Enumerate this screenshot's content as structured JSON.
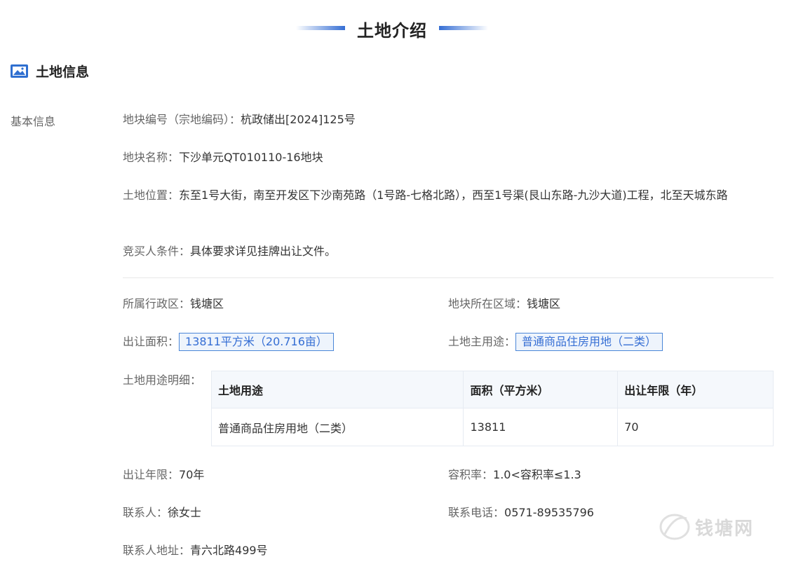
{
  "header": {
    "title": "土地介绍"
  },
  "section": {
    "title": "土地信息"
  },
  "side_label": "基本信息",
  "basic": {
    "parcel_no": {
      "label": "地块编号（宗地编码）：",
      "value": "杭政储出[2024]125号"
    },
    "parcel_name": {
      "label": "地块名称：",
      "value": "下沙单元QT010110-16地块"
    },
    "location": {
      "label": "土地位置：",
      "value": "东至1号大街，南至开发区下沙南苑路（1号路-七格北路），西至1号渠(艮山东路-九沙大道)工程，北至天城东路"
    },
    "bidder": {
      "label": "竞买人条件：",
      "value": "具体要求详见挂牌出让文件。"
    }
  },
  "details": {
    "district": {
      "label": "所属行政区：",
      "value": "钱塘区"
    },
    "area_region": {
      "label": "地块所在区域：",
      "value": "钱塘区"
    },
    "land_area": {
      "label": "出让面积：",
      "value": "13811平方米（20.716亩）"
    },
    "main_use": {
      "label": "土地主用途：",
      "value": "普通商品住房用地（二类）"
    },
    "use_detail_label": "土地用途明细：",
    "term": {
      "label": "出让年限：",
      "value": "70年"
    },
    "far": {
      "label": "容积率：",
      "value": "1.0<容积率≤1.3"
    },
    "contact": {
      "label": "联系人：",
      "value": "徐女士"
    },
    "phone": {
      "label": "联系电话：",
      "value": "0571-89535796"
    },
    "address": {
      "label": "联系人地址：",
      "value": "青六北路499号"
    }
  },
  "usage_table": {
    "headers": [
      "土地用途",
      "面积（平方米）",
      "出让年限（年）"
    ],
    "rows": [
      [
        "普通商品住房用地（二类）",
        "13811",
        "70"
      ]
    ]
  },
  "watermark": {
    "text": "钱塘网"
  },
  "colors": {
    "accent": "#356ed4",
    "label": "#666666",
    "text": "#333333"
  }
}
